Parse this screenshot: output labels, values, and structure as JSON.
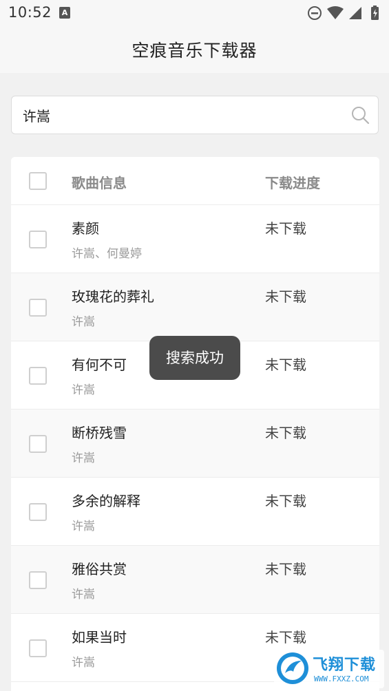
{
  "status_bar": {
    "time": "10:52",
    "notification_icon": "A"
  },
  "app": {
    "title": "空痕音乐下载器"
  },
  "search": {
    "value": "许嵩"
  },
  "list": {
    "header": {
      "title_col": "歌曲信息",
      "progress_col": "下载进度"
    },
    "rows": [
      {
        "name": "素颜",
        "artist": "许嵩、何曼婷",
        "status": "未下载"
      },
      {
        "name": "玫瑰花的葬礼",
        "artist": "许嵩",
        "status": "未下载"
      },
      {
        "name": "有何不可",
        "artist": "许嵩",
        "status": "未下载"
      },
      {
        "name": "断桥残雪",
        "artist": "许嵩",
        "status": "未下载"
      },
      {
        "name": "多余的解释",
        "artist": "许嵩",
        "status": "未下载"
      },
      {
        "name": "雅俗共赏",
        "artist": "许嵩",
        "status": "未下载"
      },
      {
        "name": "如果当时",
        "artist": "许嵩",
        "status": "未下载"
      }
    ]
  },
  "toast": {
    "message": "搜索成功"
  },
  "watermark": {
    "text": "飞翔下载",
    "url": "WWW.FXXZ.COM"
  },
  "colors": {
    "background": "#f1f1f1",
    "toast": "#3c3c3c",
    "watermark": "#1e8fd8"
  }
}
